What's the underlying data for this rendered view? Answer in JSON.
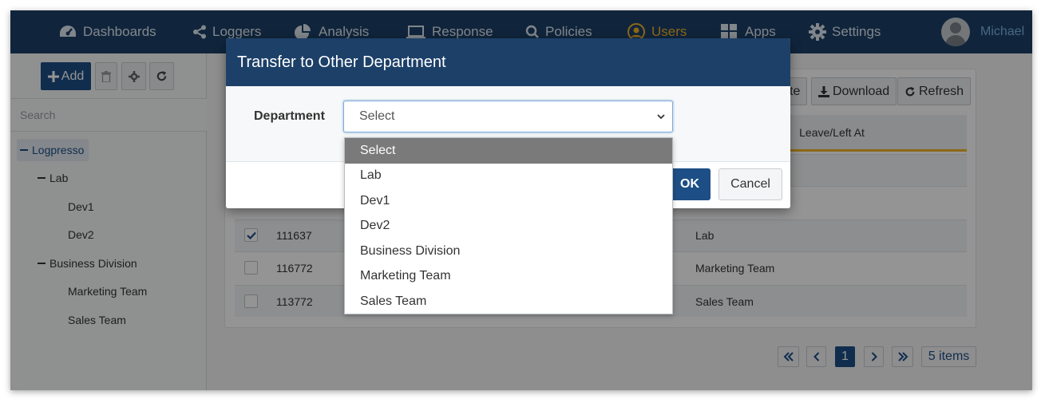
{
  "nav": {
    "items": [
      {
        "label": "Dashboards",
        "icon": "dashboard-icon"
      },
      {
        "label": "Loggers",
        "icon": "share-icon"
      },
      {
        "label": "Analysis",
        "icon": "pie-chart-icon"
      },
      {
        "label": "Response",
        "icon": "laptop-icon"
      },
      {
        "label": "Policies",
        "icon": "search-icon"
      },
      {
        "label": "Users",
        "icon": "user-circle-icon"
      },
      {
        "label": "Apps",
        "icon": "grid-icon"
      },
      {
        "label": "Settings",
        "icon": "gear-icon"
      }
    ],
    "active": "Users",
    "user_name": "Michael"
  },
  "sidebar": {
    "add_label": "Add",
    "search_placeholder": "Search",
    "tree": {
      "root": "Logpresso",
      "lab": "Lab",
      "dev1": "Dev1",
      "dev2": "Dev2",
      "business": "Business Division",
      "marketing": "Marketing Team",
      "sales": "Sales Team"
    }
  },
  "main": {
    "partial_button": "te",
    "download_label": "Download",
    "refresh_label": "Refresh",
    "column_leave": "Leave/Left At",
    "rows": [
      {
        "id": "111637",
        "dept": "Lab",
        "checked": true
      },
      {
        "id": "116772",
        "dept": "Marketing Team",
        "checked": false
      },
      {
        "id": "113772",
        "dept": "Sales Team",
        "checked": false
      }
    ],
    "pagination": {
      "current": "1",
      "items_label": "5 items"
    }
  },
  "modal": {
    "title": "Transfer to Other Department",
    "department_label": "Department",
    "select_value": "Select",
    "ok_label": "OK",
    "cancel_label": "Cancel",
    "options": [
      "Select",
      "Lab",
      "Dev1",
      "Dev2",
      "Business Division",
      "Marketing Team",
      "Sales Team"
    ]
  },
  "colors": {
    "nav_bg": "#1d4068",
    "accent": "#f0b429",
    "primary": "#1d4f86"
  }
}
